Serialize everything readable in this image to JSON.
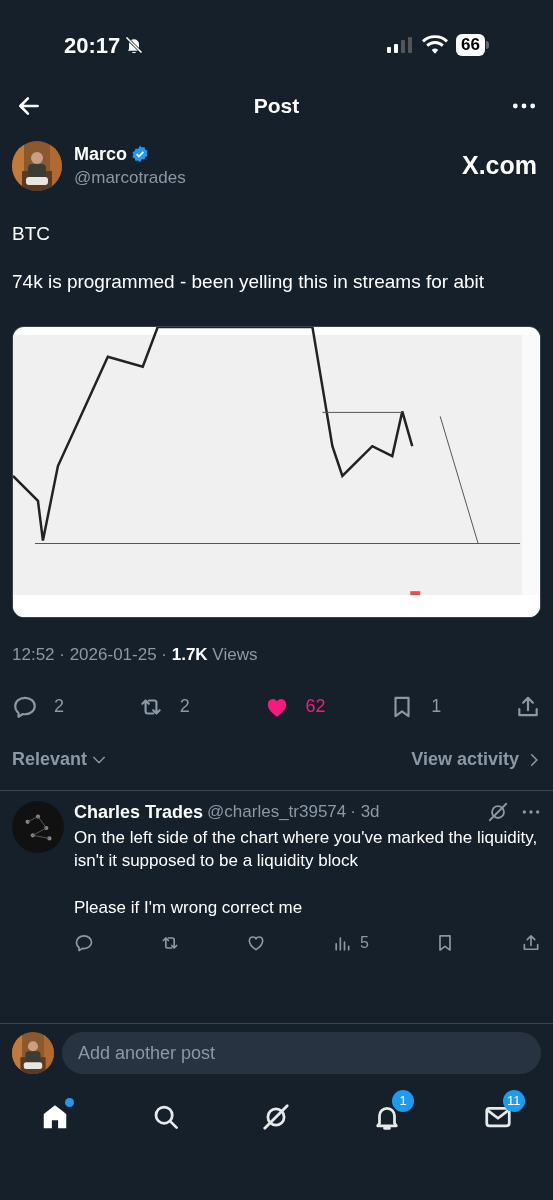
{
  "status_bar": {
    "time": "20:17",
    "battery": "66"
  },
  "header": {
    "title": "Post"
  },
  "author": {
    "name": "Marco",
    "handle": "@marcotrades",
    "verified": true,
    "site": "X.com"
  },
  "post": {
    "paragraphs": [
      "BTC",
      "74k is programmed - been yelling this in streams for abit"
    ],
    "meta": "12:52 · 2026-01-25 · **1.7K** Views",
    "actions": [
      {
        "kind": "reply",
        "count": "2",
        "active": false
      },
      {
        "kind": "repost",
        "count": "2",
        "active": false
      },
      {
        "kind": "like",
        "count": "62",
        "active": true
      },
      {
        "kind": "bookmark",
        "count": "1",
        "active": false
      },
      {
        "kind": "share",
        "active": false
      }
    ]
  },
  "sort": {
    "label": "Relevant",
    "link": "View activity"
  },
  "replies": [
    {
      "name": "Charles Trades",
      "handle": "@charles_tr39574",
      "age": "· 3d",
      "paragraphs": [
        "On the left side of the chart where you've marked the liquidity, isn't it supposed to be a liquidity block",
        "Please if I'm wrong correct me"
      ],
      "actions": [
        {
          "kind": "reply"
        },
        {
          "kind": "repost"
        },
        {
          "kind": "like"
        },
        {
          "kind": "views",
          "count": "5"
        },
        {
          "kind": "bookmark"
        },
        {
          "kind": "share"
        }
      ]
    }
  ],
  "composer": {
    "placeholder": "Add another post"
  },
  "nav": [
    {
      "kind": "home",
      "selected": true,
      "dot": true
    },
    {
      "kind": "search",
      "selected": false
    },
    {
      "kind": "grok",
      "selected": false
    },
    {
      "kind": "notifications",
      "selected": false,
      "badge": "1"
    },
    {
      "kind": "messages",
      "selected": false,
      "badge": "11"
    }
  ]
}
